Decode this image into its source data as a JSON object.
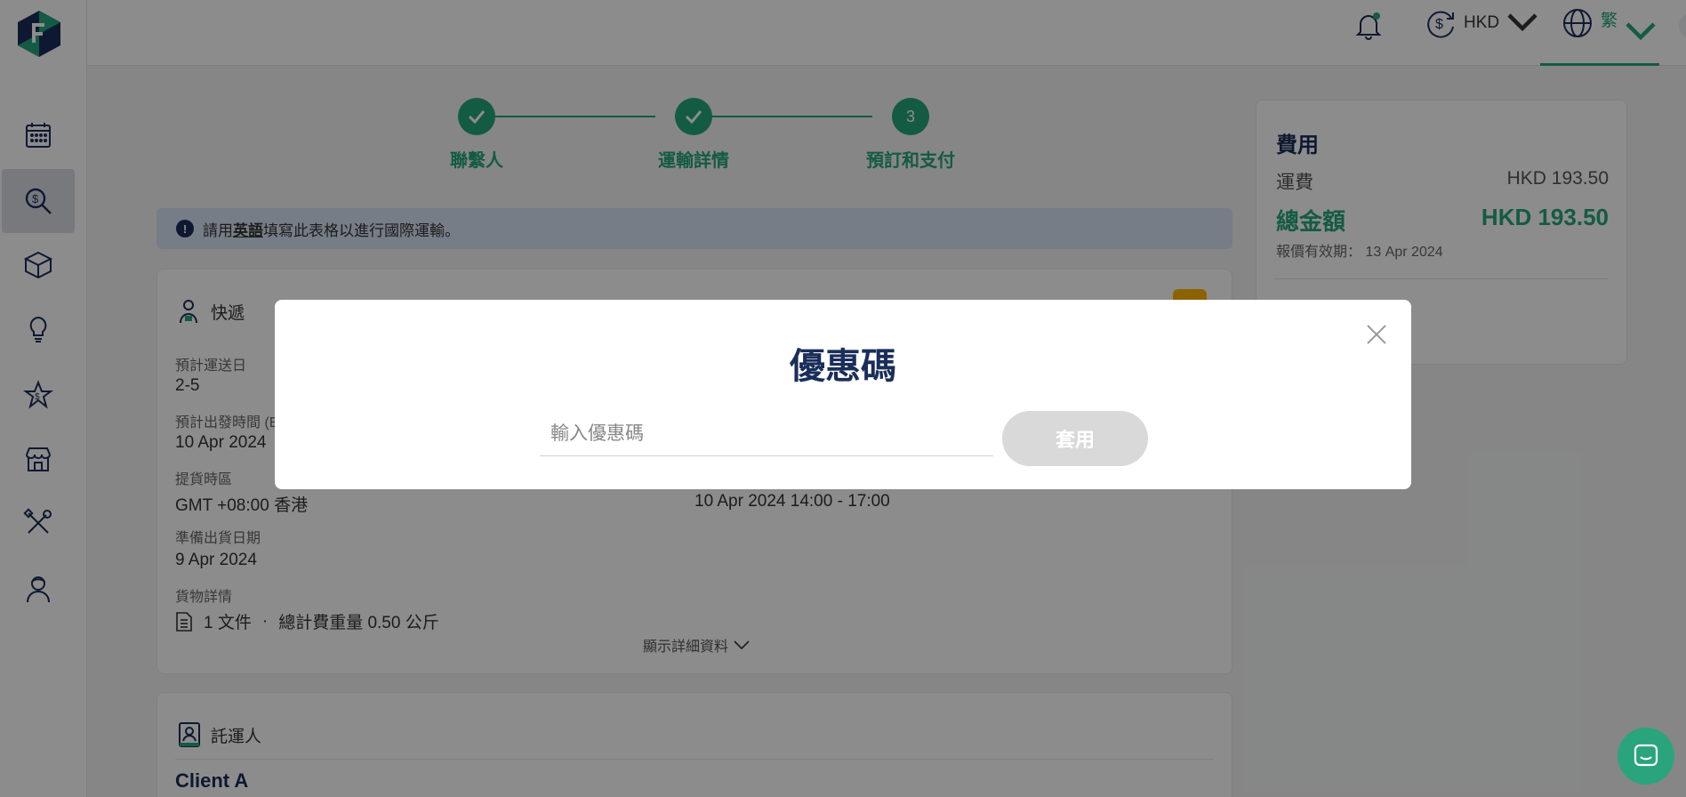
{
  "sidebar": {
    "items": [
      {
        "icon": "calendar-icon"
      },
      {
        "icon": "price-search-icon",
        "active": true
      },
      {
        "icon": "box-icon"
      },
      {
        "icon": "lightbulb-icon"
      },
      {
        "icon": "star-dollar-icon"
      },
      {
        "icon": "store-icon"
      },
      {
        "icon": "tools-icon"
      },
      {
        "icon": "agent-icon"
      }
    ]
  },
  "topbar": {
    "currency": "HKD",
    "language": "繁"
  },
  "stepper": {
    "steps": [
      {
        "label": "聯繫人",
        "state": "done"
      },
      {
        "label": "運輸詳情",
        "state": "done"
      },
      {
        "label": "預訂和支付",
        "state": "current",
        "number": "3"
      }
    ]
  },
  "notice": {
    "prefix": "請用",
    "highlight": "英語",
    "suffix": "填寫此表格以進行國際運輸。"
  },
  "express_card": {
    "title": "快遞",
    "est_delivery_label": "預計運送日",
    "est_delivery_value": "2-5",
    "est_departure_label": "預計出發時間 (E",
    "est_departure_value": "10 Apr 2024",
    "pickup_tz_label": "提貨時區",
    "pickup_tz_value": "GMT +08:00 香港",
    "pickup_time_value": "10 Apr 2024 14:00 - 17:00",
    "ready_date_label": "準備出貨日期",
    "ready_date_value": "9 Apr 2024",
    "cargo_label": "貨物詳情",
    "cargo_count": "1 文件",
    "cargo_sep": "·",
    "cargo_weight": "總計費重量 0.50 公斤",
    "show_more": "顯示詳細資料"
  },
  "shipper_card": {
    "title": "託運人",
    "client": "Client A"
  },
  "fee_card": {
    "title": "費用",
    "freight_label": "運費",
    "freight_value": "HKD 193.50",
    "total_label": "總金額",
    "total_value": "HKD 193.50",
    "valid_label": "報價有效期：",
    "valid_date": "13 Apr 2024"
  },
  "modal": {
    "title": "優惠碼",
    "input_placeholder": "輸入優惠碼",
    "input_value": "",
    "apply_label": "套用"
  },
  "colors": {
    "accent": "#26a67c",
    "navy": "#1a2e5a"
  }
}
